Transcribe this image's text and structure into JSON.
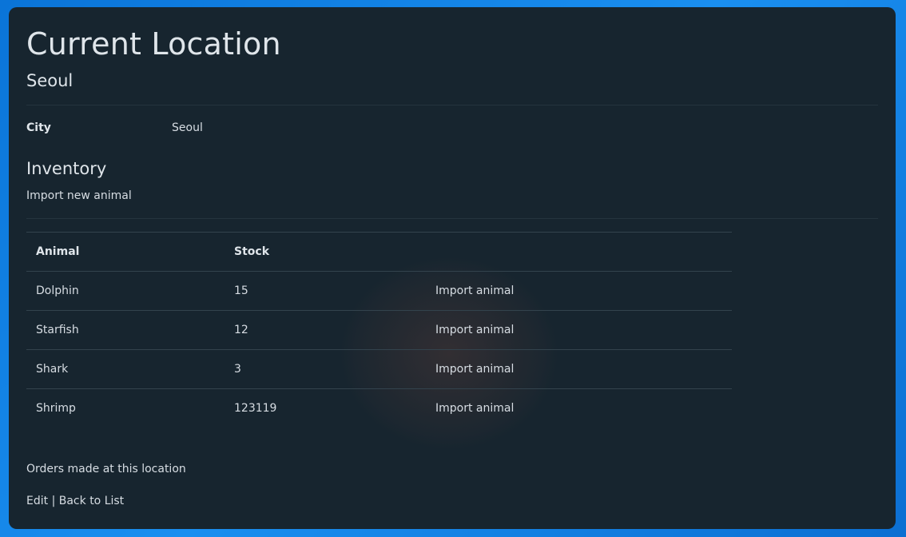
{
  "page": {
    "title": "Current Location",
    "subtitle": "Seoul"
  },
  "details": {
    "city_label": "City",
    "city_value": "Seoul"
  },
  "inventory": {
    "title": "Inventory",
    "import_new_label": "Import new animal",
    "columns": [
      "Animal",
      "Stock",
      ""
    ],
    "rows": [
      {
        "animal": "Dolphin",
        "stock": "15",
        "action": "Import animal"
      },
      {
        "animal": "Starfish",
        "stock": "12",
        "action": "Import animal"
      },
      {
        "animal": "Shark",
        "stock": "3",
        "action": "Import animal"
      },
      {
        "animal": "Shrimp",
        "stock": "123119",
        "action": "Import animal"
      }
    ]
  },
  "links": {
    "orders": "Orders made at this location",
    "edit": "Edit",
    "separator": "|",
    "back": "Back to List"
  }
}
